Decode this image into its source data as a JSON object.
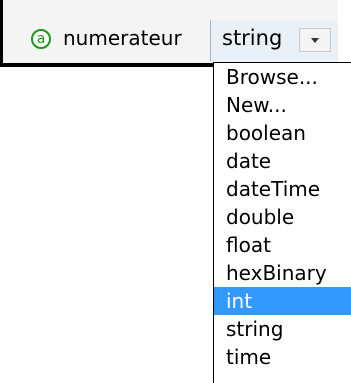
{
  "attribute": {
    "icon_symbol": "a",
    "name": "numerateur"
  },
  "type_combo": {
    "value": "string"
  },
  "dropdown": {
    "items": [
      "Browse...",
      "New...",
      "boolean",
      "date",
      "dateTime",
      "double",
      "float",
      "hexBinary",
      "int",
      "string",
      "time"
    ],
    "selected": "int"
  },
  "colors": {
    "selection_background": "#3399ff",
    "attribute_icon": "#179917",
    "combo_background": "#e8f0f8"
  }
}
